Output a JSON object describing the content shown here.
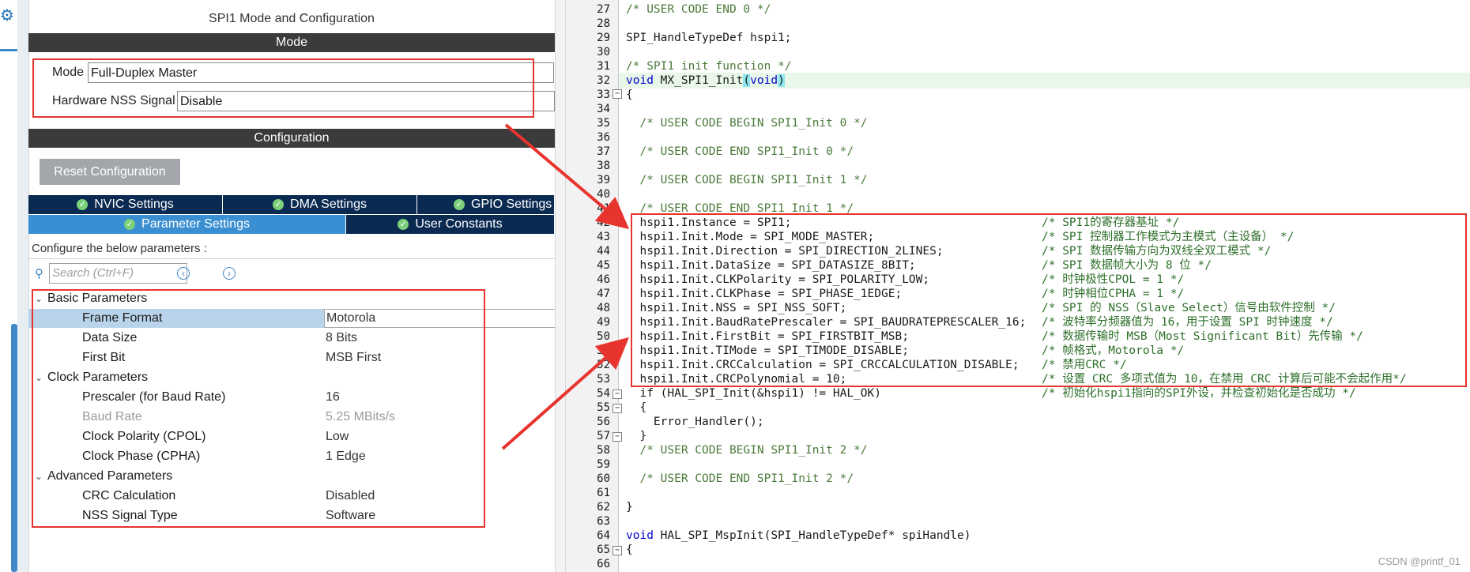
{
  "left_panel": {
    "title": "SPI1 Mode and Configuration",
    "mode_header": "Mode",
    "mode_label": "Mode",
    "mode_value": "Full-Duplex Master",
    "nss_label": "Hardware NSS Signal",
    "nss_value": "Disable",
    "config_header": "Configuration",
    "reset_button": "Reset Configuration",
    "tabs_row1": [
      "NVIC Settings",
      "DMA Settings",
      "GPIO Settings"
    ],
    "tabs_row2": [
      "Parameter Settings",
      "User Constants"
    ],
    "configure_text": "Configure the below parameters :",
    "search_placeholder": "Search (Ctrl+F)",
    "groups": {
      "basic": "Basic Parameters",
      "clock": "Clock Parameters",
      "advanced": "Advanced Parameters"
    },
    "params": [
      {
        "name": "Frame Format",
        "value": "Motorola"
      },
      {
        "name": "Data Size",
        "value": "8 Bits"
      },
      {
        "name": "First Bit",
        "value": "MSB First"
      },
      {
        "name": "Prescaler (for Baud Rate)",
        "value": "16"
      },
      {
        "name": "Baud Rate",
        "value": "5.25 MBits/s"
      },
      {
        "name": "Clock Polarity (CPOL)",
        "value": "Low"
      },
      {
        "name": "Clock Phase (CPHA)",
        "value": "1 Edge"
      },
      {
        "name": "CRC Calculation",
        "value": "Disabled"
      },
      {
        "name": "NSS Signal Type",
        "value": "Software"
      }
    ],
    "accent_color": "#3e87c9",
    "tab_dark_color": "#0b2a52",
    "highlight_color": "#e8342e"
  },
  "editor": {
    "line_numbers": [
      "27",
      "28",
      "29",
      "30",
      "31",
      "32",
      "33",
      "34",
      "35",
      "36",
      "37",
      "38",
      "39",
      "40",
      "41",
      "42",
      "43",
      "44",
      "45",
      "46",
      "47",
      "48",
      "49",
      "50",
      "51",
      "52",
      "53",
      "54",
      "55",
      "56",
      "57",
      "58",
      "59",
      "60",
      "61",
      "62",
      "63",
      "64",
      "65",
      "66"
    ],
    "lines": {
      "l27": "/* USER CODE END 0 */",
      "l29": "SPI_HandleTypeDef hspi1;",
      "l31": "/* SPI1 init function */",
      "l32_kw": "void",
      "l32_fn": " MX_SPI1_Init",
      "l32_open": "(",
      "l32_arg": "void",
      "l32_close": ")",
      "l33": "{",
      "l35": "  /* USER CODE BEGIN SPI1_Init 0 */",
      "l37": "  /* USER CODE END SPI1_Init 0 */",
      "l39": "  /* USER CODE BEGIN SPI1_Init 1 */",
      "l41": "  /* USER CODE END SPI1_Init 1 */",
      "l42": "  hspi1.Instance = SPI1;",
      "l42c": "/* SPI1的寄存器基址 */",
      "l43": "  hspi1.Init.Mode = SPI_MODE_MASTER;",
      "l43c": "/* SPI 控制器工作模式为主模式（主设备） */",
      "l44": "  hspi1.Init.Direction = SPI_DIRECTION_2LINES;",
      "l44c": "/* SPI 数据传输方向为双线全双工模式 */",
      "l45": "  hspi1.Init.DataSize = SPI_DATASIZE_8BIT;",
      "l45c": "/* SPI 数据帧大小为 8 位 */",
      "l46": "  hspi1.Init.CLKPolarity = SPI_POLARITY_LOW;",
      "l46c": "/* 时钟极性CPOL = 1 */",
      "l47": "  hspi1.Init.CLKPhase = SPI_PHASE_1EDGE;",
      "l47c": "/* 时钟相位CPHA = 1 */",
      "l48": "  hspi1.Init.NSS = SPI_NSS_SOFT;",
      "l48c": "/* SPI 的 NSS（Slave Select）信号由软件控制 */",
      "l49": "  hspi1.Init.BaudRatePrescaler = SPI_BAUDRATEPRESCALER_16;",
      "l49c": "/* 波特率分频器值为 16，用于设置 SPI 时钟速度 */",
      "l50": "  hspi1.Init.FirstBit = SPI_FIRSTBIT_MSB;",
      "l50c": "/* 数据传输时 MSB（Most Significant Bit）先传输 */",
      "l51": "  hspi1.Init.TIMode = SPI_TIMODE_DISABLE;",
      "l51c": "/* 帧格式，Motorola */",
      "l52": "  hspi1.Init.CRCCalculation = SPI_CRCCALCULATION_DISABLE;",
      "l52c": "/* 禁用CRC */",
      "l53a": "  hspi1.Init.CRCPolynomial = ",
      "l53n": "10",
      "l53b": ";",
      "l53c": "/* 设置 CRC 多项式值为 10，在禁用 CRC 计算后可能不会起作用*/",
      "l54": "  if (HAL_SPI_Init(&hspi1) != HAL_OK)",
      "l54c": "/* 初始化hspi1指向的SPI外设，并检查初始化是否成功 */",
      "l55": "  {",
      "l56": "    Error_Handler();",
      "l57": "  }",
      "l58": "  /* USER CODE BEGIN SPI1_Init 2 */",
      "l60": "  /* USER CODE END SPI1_Init 2 */",
      "l62": "}",
      "l64_kw": "void",
      "l64": " HAL_SPI_MspInit(SPI_HandleTypeDef* spiHandle)",
      "l65": "{"
    }
  },
  "watermark": "CSDN @printf_01"
}
